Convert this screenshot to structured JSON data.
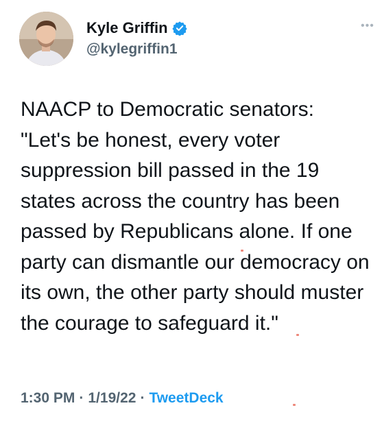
{
  "author": {
    "display_name": "Kyle Griffin",
    "handle": "@kylegriffin1",
    "verified_icon": "verified-badge-icon"
  },
  "tweet": {
    "text": "NAACP to Democratic senators:\n\"Let's be honest, every voter suppression bill passed in the 19 states across the country has been passed by Republicans alone. If one party can dismantle our democracy on its own, the other party should muster the courage to safeguard it.\""
  },
  "meta": {
    "time": "1:30 PM",
    "separator": "·",
    "date": "1/19/22",
    "source": "TweetDeck"
  },
  "colors": {
    "text": "#0f1419",
    "muted": "#536471",
    "link": "#1d9bf0",
    "verified": "#1d9bf0"
  }
}
